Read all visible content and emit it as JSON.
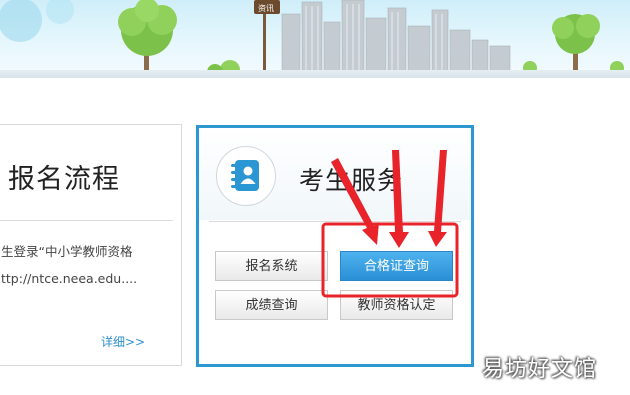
{
  "flow_card": {
    "title": "报名流程",
    "text_line1": "生登录“中小学教师资格",
    "text_line2": "ttp://ntce.neea.edu....",
    "more_link": "详细>>"
  },
  "service_card": {
    "title": "考生服务",
    "icon": "contact-book-icon",
    "buttons": {
      "registration": "报名系统",
      "certificate_query": "合格证查询",
      "score_query": "成绩查询",
      "teacher_cert": "教师资格认定"
    }
  },
  "annotation": {
    "highlight_color": "#e8232a",
    "arrow_count": 3,
    "highlighted_item": "合格证查询"
  },
  "banner": {
    "sign_text": "资讯"
  },
  "watermark": "易坊好文馆",
  "colors": {
    "accent_border": "#2c98cf",
    "primary_button": "#3a9fe2",
    "link": "#2f8fcf"
  }
}
